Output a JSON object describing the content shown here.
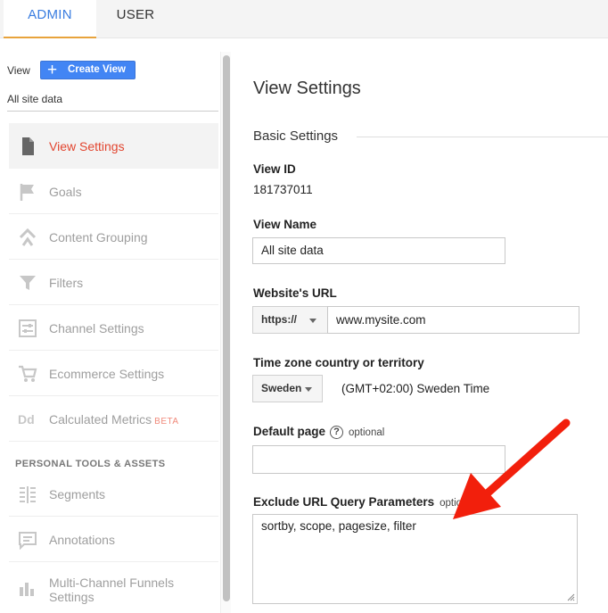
{
  "tabs": {
    "admin": "ADMIN",
    "user": "USER"
  },
  "view_selector": {
    "label": "View",
    "create_button": "Create View",
    "current_view": "All site data"
  },
  "nav": {
    "items": [
      {
        "label": "View Settings",
        "icon": "document-icon"
      },
      {
        "label": "Goals",
        "icon": "flag-icon"
      },
      {
        "label": "Content Grouping",
        "icon": "content-grouping-icon"
      },
      {
        "label": "Filters",
        "icon": "filter-icon"
      },
      {
        "label": "Channel Settings",
        "icon": "channel-settings-icon"
      },
      {
        "label": "Ecommerce Settings",
        "icon": "cart-icon"
      },
      {
        "label": "Calculated Metrics",
        "icon": "calculated-metrics-icon",
        "badge": "BETA"
      }
    ],
    "section_header": "PERSONAL TOOLS & ASSETS",
    "personal_items": [
      {
        "label": "Segments",
        "icon": "segments-icon"
      },
      {
        "label": "Annotations",
        "icon": "annotations-icon"
      },
      {
        "label_line1": "Multi-Channel Funnels",
        "label_line2": "Settings",
        "icon": "bar-chart-icon"
      }
    ]
  },
  "main": {
    "title": "View Settings",
    "section": "Basic Settings",
    "view_id": {
      "label": "View ID",
      "value": "181737011"
    },
    "view_name": {
      "label": "View Name",
      "value": "All site data"
    },
    "website_url": {
      "label": "Website's URL",
      "protocol": "https://",
      "value": "www.mysite.com"
    },
    "timezone": {
      "label": "Time zone country or territory",
      "country": "Sweden",
      "value": "(GMT+02:00) Sweden Time"
    },
    "default_page": {
      "label": "Default page",
      "help": "?",
      "optional": "optional",
      "value": ""
    },
    "exclude_params": {
      "label": "Exclude URL Query Parameters",
      "optional": "optio",
      "value": "sortby, scope, pagesize, filter"
    }
  },
  "colors": {
    "accent": "#4285f4",
    "active_nav": "#e2452f",
    "tab_underline": "#e8a33c",
    "arrow": "#f21f0c"
  }
}
